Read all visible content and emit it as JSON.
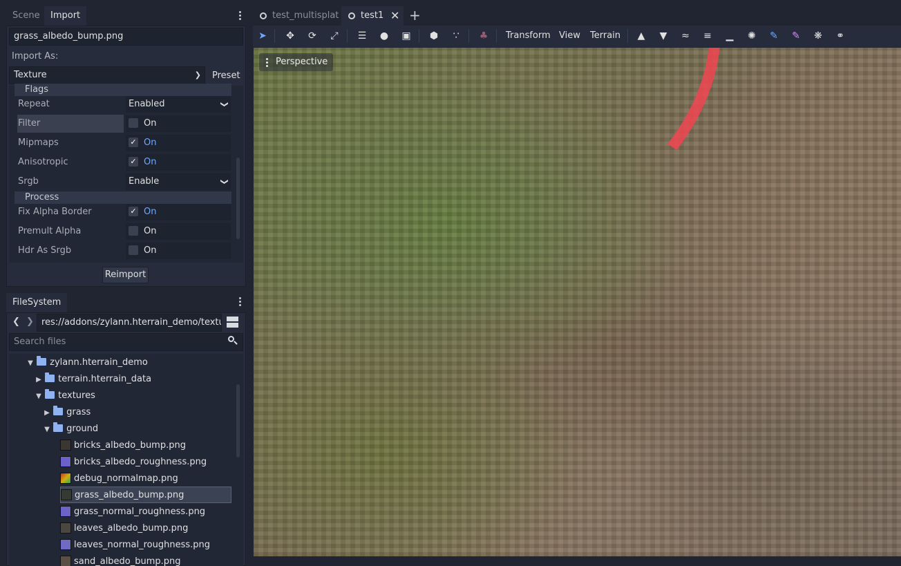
{
  "left_dock": {
    "tabs": [
      {
        "label": "Scene",
        "active": false
      },
      {
        "label": "Import",
        "active": true
      }
    ],
    "import": {
      "file_name": "grass_albedo_bump.png",
      "import_as_label": "Import As:",
      "import_as_value": "Texture",
      "preset_label": "Preset",
      "sections": {
        "flags": "Flags",
        "process": "Process"
      },
      "properties": {
        "repeat": {
          "name": "Repeat",
          "value": "Enabled"
        },
        "filter": {
          "name": "Filter",
          "value": "On",
          "checked": false
        },
        "mipmaps": {
          "name": "Mipmaps",
          "value": "On",
          "checked": true
        },
        "anisotropic": {
          "name": "Anisotropic",
          "value": "On",
          "checked": true
        },
        "srgb": {
          "name": "Srgb",
          "value": "Enable"
        },
        "fix_alpha_border": {
          "name": "Fix Alpha Border",
          "value": "On",
          "checked": true
        },
        "premult_alpha": {
          "name": "Premult Alpha",
          "value": "On",
          "checked": false
        },
        "hdr_as_srgb": {
          "name": "Hdr As Srgb",
          "value": "On",
          "checked": false
        }
      },
      "reimport_label": "Reimport"
    },
    "filesystem": {
      "tab_label": "FileSystem",
      "path": "res://addons/zylann.hterrain_demo/textur",
      "search_placeholder": "Search files",
      "tree": [
        {
          "label": "zylann.hterrain_demo",
          "type": "folder",
          "expanded": true
        },
        {
          "label": "terrain.hterrain_data",
          "type": "folder",
          "expanded": false
        },
        {
          "label": "textures",
          "type": "folder",
          "expanded": true
        },
        {
          "label": "grass",
          "type": "folder",
          "expanded": false
        },
        {
          "label": "ground",
          "type": "folder",
          "expanded": true
        },
        {
          "label": "bricks_albedo_bump.png",
          "type": "file",
          "thumb": "#3a3732"
        },
        {
          "label": "bricks_albedo_roughness.png",
          "type": "file",
          "thumb": "#6b62c9"
        },
        {
          "label": "debug_normalmap.png",
          "type": "file",
          "thumb": "#b08a2a"
        },
        {
          "label": "grass_albedo_bump.png",
          "type": "file",
          "thumb": "#353a33",
          "selected": true
        },
        {
          "label": "grass_normal_roughness.png",
          "type": "file",
          "thumb": "#6c63c8"
        },
        {
          "label": "leaves_albedo_bump.png",
          "type": "file",
          "thumb": "#4a4640"
        },
        {
          "label": "leaves_normal_roughness.png",
          "type": "file",
          "thumb": "#6f6ac4"
        },
        {
          "label": "sand_albedo_bump.png",
          "type": "file",
          "thumb": "#5a4f44"
        }
      ]
    }
  },
  "editor": {
    "scene_tabs": [
      {
        "label": "test_multisplat",
        "active": false
      },
      {
        "label": "test1",
        "active": true
      }
    ],
    "toolbar": {
      "menus": {
        "transform": "Transform",
        "view": "View",
        "terrain": "Terrain"
      }
    },
    "viewport": {
      "perspective_label": "Perspective"
    }
  },
  "colors": {
    "accent": "#6fa8ff",
    "panel_bg": "#262c3b",
    "window_bg": "#202531",
    "terrain_tool_blue": "#6fa8ff"
  }
}
